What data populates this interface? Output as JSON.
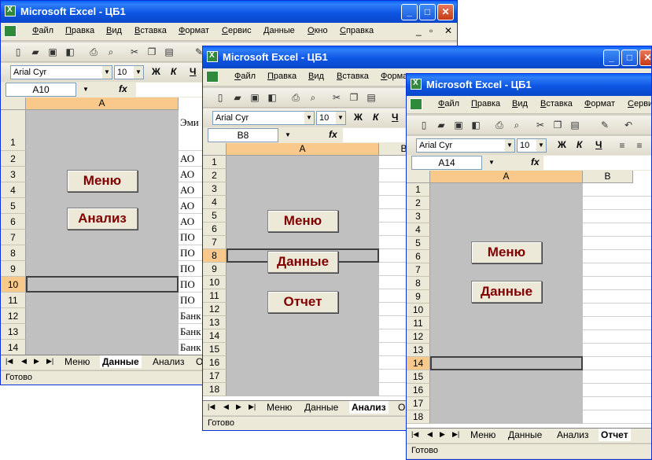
{
  "app_title": "Microsoft Excel - ЦБ1",
  "menu": [
    "Файл",
    "Правка",
    "Вид",
    "Вставка",
    "Формат",
    "Сервис",
    "Данные",
    "Окно",
    "Справка"
  ],
  "font": {
    "name": "Arial Cyr",
    "size": "10"
  },
  "format_buttons": {
    "bold": "Ж",
    "italic": "К",
    "underline": "Ч"
  },
  "fx_label": "fx",
  "status": "Готово",
  "windows": [
    {
      "name_box": "A10",
      "columns": [
        "A"
      ],
      "rows": [
        "1",
        "2",
        "3",
        "4",
        "5",
        "6",
        "7",
        "8",
        "9",
        "10",
        "11",
        "12",
        "13",
        "14"
      ],
      "selected_row": "10",
      "buttons": [
        "Меню",
        "Анализ"
      ],
      "col_b_text": [
        "Эми",
        "АО",
        "АО",
        "АО",
        "АО",
        "АО",
        "ПО",
        "ПО",
        "ПО",
        "ПО",
        "ПО",
        "Банк",
        "Банк",
        "Банк"
      ],
      "tabs": [
        "Меню",
        "Данные",
        "Анализ",
        "О"
      ],
      "active_tab": "Данные"
    },
    {
      "name_box": "B8",
      "columns": [
        "A",
        "B"
      ],
      "rows": [
        "1",
        "2",
        "3",
        "4",
        "5",
        "6",
        "7",
        "8",
        "9",
        "10",
        "11",
        "12",
        "13",
        "14",
        "15",
        "16",
        "17",
        "18"
      ],
      "selected_row": "8",
      "buttons": [
        "Меню",
        "Данные",
        "Отчет"
      ],
      "tabs": [
        "Меню",
        "Данные",
        "Анализ",
        "О"
      ],
      "active_tab": "Анализ"
    },
    {
      "name_box": "A14",
      "columns": [
        "A",
        "B"
      ],
      "rows": [
        "1",
        "2",
        "3",
        "4",
        "5",
        "6",
        "7",
        "8",
        "9",
        "10",
        "11",
        "12",
        "13",
        "14",
        "15",
        "16",
        "17",
        "18"
      ],
      "selected_row": "14",
      "buttons": [
        "Меню",
        "Данные"
      ],
      "tabs": [
        "Меню",
        "Данные",
        "Анализ",
        "Отчет"
      ],
      "active_tab": "Отчет"
    }
  ]
}
